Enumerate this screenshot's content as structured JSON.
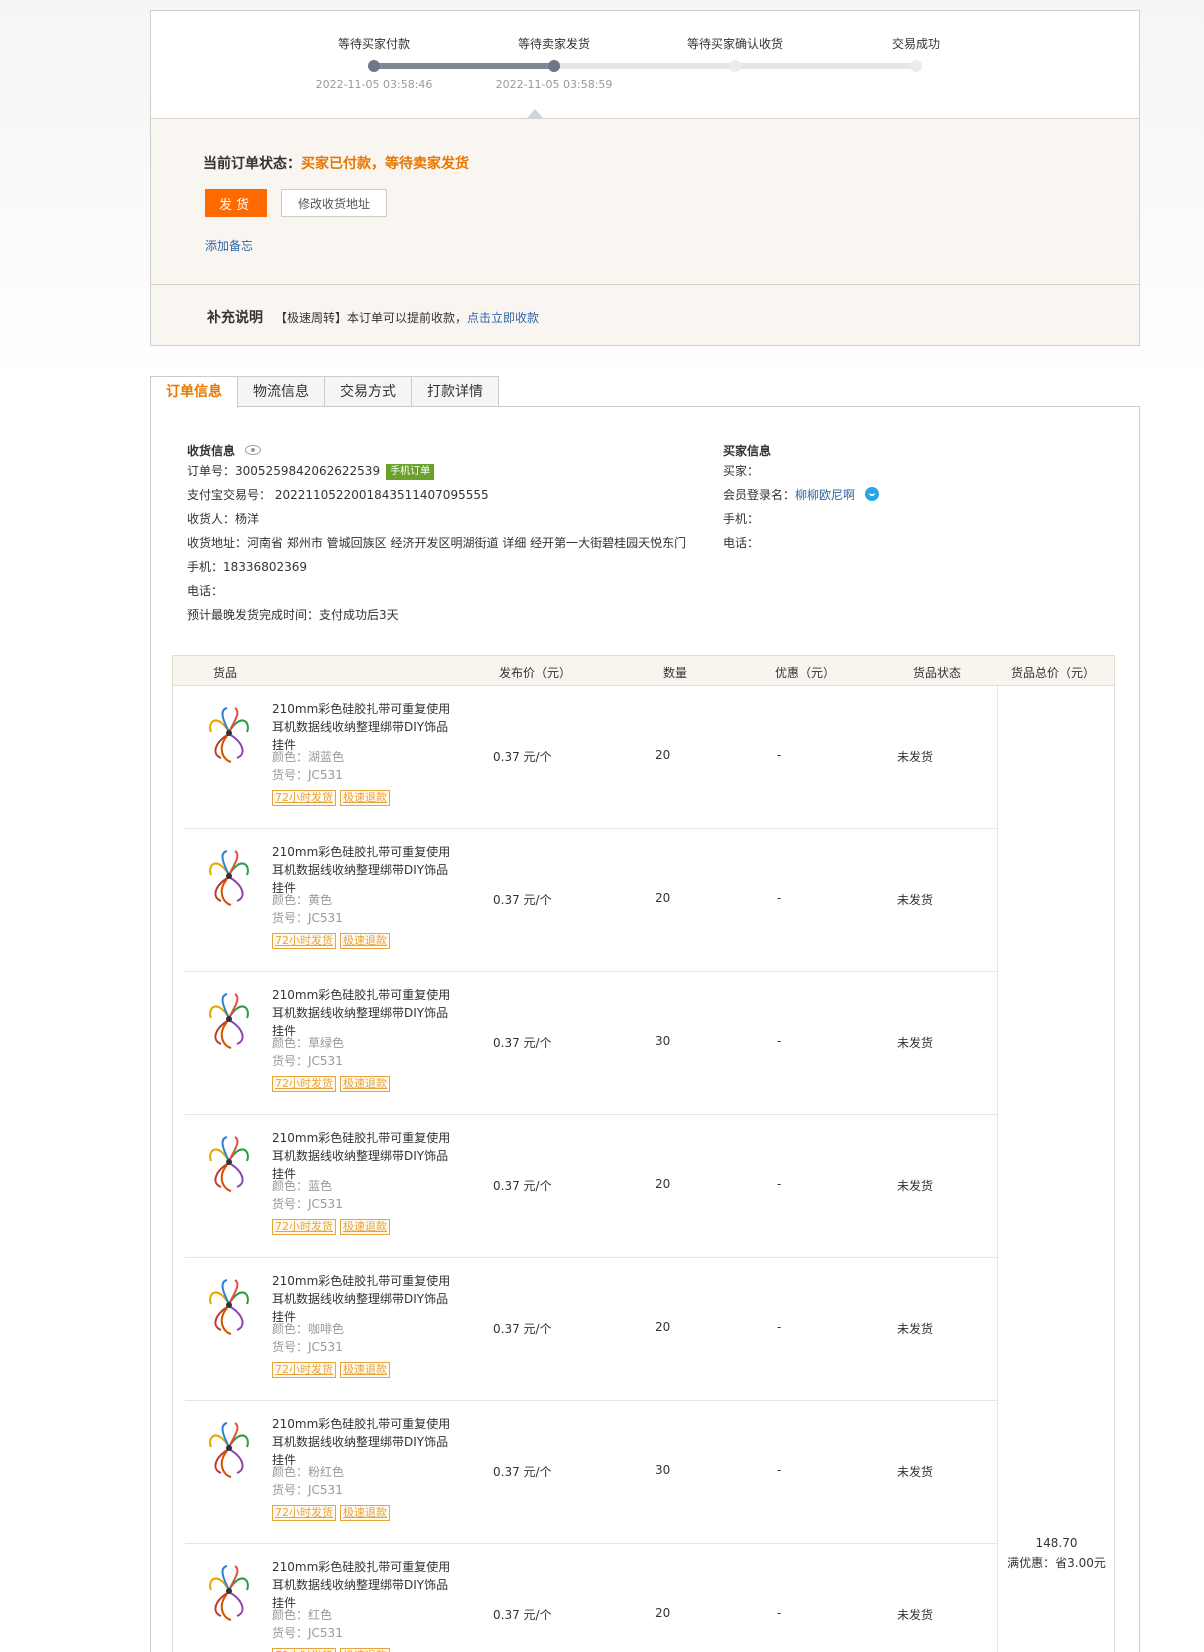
{
  "progress": {
    "steps": [
      {
        "label": "等待买家付款",
        "time": "2022-11-05 03:58:46",
        "done": true
      },
      {
        "label": "等待卖家发货",
        "time": "2022-11-05 03:58:59",
        "done": true
      },
      {
        "label": "等待买家确认收货",
        "time": "",
        "done": false
      },
      {
        "label": "交易成功",
        "time": "",
        "done": false
      }
    ]
  },
  "status": {
    "label": "当前订单状态：",
    "value": "买家已付款，等待卖家发货",
    "ship_button": "发货",
    "modify_address_button": "修改收货地址",
    "add_note_link": "添加备忘"
  },
  "supplement": {
    "title": "补充说明",
    "text": "【极速周转】本订单可以提前收款，",
    "link": "点击立即收款"
  },
  "tabs": [
    "订单信息",
    "物流信息",
    "交易方式",
    "打款详情"
  ],
  "receive_info": {
    "title": "收货信息",
    "order_no_label": "订单号：",
    "order_no": "3005259842062622539",
    "mobile_tag": "手机订单",
    "alipay_label": "支付宝交易号：",
    "alipay_no": "2022110522001843511407095555",
    "receiver_label": "收货人：",
    "receiver": "杨洋",
    "address_label": "收货地址：",
    "address": "河南省 郑州市 管城回族区 经济开发区明湖街道 详细 经开第一大街碧桂园天悦东门",
    "phone_label": "手机：",
    "phone": "18336802369",
    "tel_label": "电话：",
    "tel": "",
    "ship_deadline_label": "预计最晚发货完成时间：",
    "ship_deadline": "支付成功后3天"
  },
  "buyer_info": {
    "title": "买家信息",
    "buyer_label": "买家：",
    "buyer": "",
    "member_label": "会员登录名：",
    "member": "柳柳欧尼啊",
    "phone_label": "手机：",
    "phone": "",
    "tel_label": "电话：",
    "tel": ""
  },
  "goods": {
    "headers": {
      "product": "货品",
      "price": "发布价（元）",
      "qty": "数量",
      "discount": "优惠（元）",
      "status": "货品状态",
      "total": "货品总价（元）"
    },
    "total_value": "148.70",
    "total_discount": "满优惠：省3.00元",
    "badge_ship": "72小时发货",
    "badge_refund": "极速退款",
    "items": [
      {
        "title": "210mm彩色硅胶扎带可重复使用耳机数据线收纳整理绑带DIY饰品挂件",
        "color": "颜色：湖蓝色",
        "sku": "货号：JC531",
        "price": "0.37 元/个",
        "qty": "20",
        "discount": "-",
        "status": "未发货"
      },
      {
        "title": "210mm彩色硅胶扎带可重复使用耳机数据线收纳整理绑带DIY饰品挂件",
        "color": "颜色：黄色",
        "sku": "货号：JC531",
        "price": "0.37 元/个",
        "qty": "20",
        "discount": "-",
        "status": "未发货"
      },
      {
        "title": "210mm彩色硅胶扎带可重复使用耳机数据线收纳整理绑带DIY饰品挂件",
        "color": "颜色：草绿色",
        "sku": "货号：JC531",
        "price": "0.37 元/个",
        "qty": "30",
        "discount": "-",
        "status": "未发货"
      },
      {
        "title": "210mm彩色硅胶扎带可重复使用耳机数据线收纳整理绑带DIY饰品挂件",
        "color": "颜色：蓝色",
        "sku": "货号：JC531",
        "price": "0.37 元/个",
        "qty": "20",
        "discount": "-",
        "status": "未发货"
      },
      {
        "title": "210mm彩色硅胶扎带可重复使用耳机数据线收纳整理绑带DIY饰品挂件",
        "color": "颜色：咖啡色",
        "sku": "货号：JC531",
        "price": "0.37 元/个",
        "qty": "20",
        "discount": "-",
        "status": "未发货"
      },
      {
        "title": "210mm彩色硅胶扎带可重复使用耳机数据线收纳整理绑带DIY饰品挂件",
        "color": "颜色：粉红色",
        "sku": "货号：JC531",
        "price": "0.37 元/个",
        "qty": "30",
        "discount": "-",
        "status": "未发货"
      },
      {
        "title": "210mm彩色硅胶扎带可重复使用耳机数据线收纳整理绑带DIY饰品挂件",
        "color": "颜色：红色",
        "sku": "货号：JC531",
        "price": "0.37 元/个",
        "qty": "20",
        "discount": "-",
        "status": "未发货"
      }
    ]
  }
}
